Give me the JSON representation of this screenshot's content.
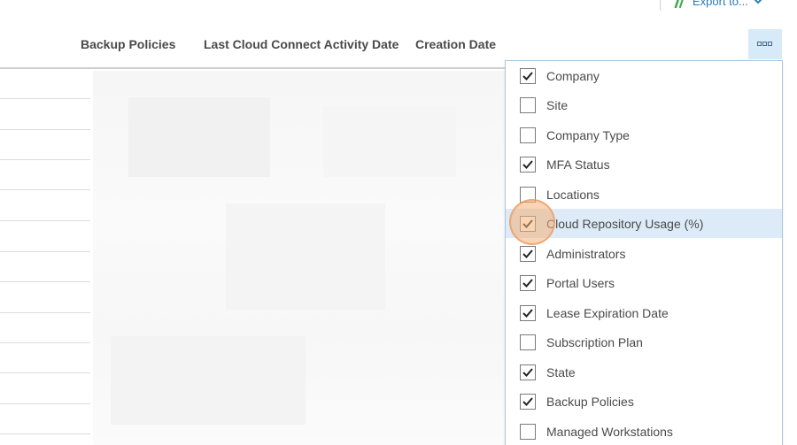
{
  "export": {
    "label": "Export to...",
    "icon": "export-icon",
    "accent": "#2a7ab8"
  },
  "columns": {
    "backup_policies": "Backup Policies",
    "last_cloud_connect_activity_date": "Last Cloud Connect Activity Date",
    "creation_date": "Creation Date"
  },
  "column_chooser": {
    "toggle_icon": "columns-icon",
    "items": [
      {
        "label": "Company",
        "checked": true
      },
      {
        "label": "Site",
        "checked": false
      },
      {
        "label": "Company Type",
        "checked": false
      },
      {
        "label": "MFA Status",
        "checked": true
      },
      {
        "label": "Locations",
        "checked": false
      },
      {
        "label": "Cloud Repository Usage (%)",
        "checked": true,
        "highlighted": true
      },
      {
        "label": "Administrators",
        "checked": true
      },
      {
        "label": "Portal Users",
        "checked": true
      },
      {
        "label": "Lease Expiration Date",
        "checked": true
      },
      {
        "label": "Subscription Plan",
        "checked": false
      },
      {
        "label": "State",
        "checked": true
      },
      {
        "label": "Backup Policies",
        "checked": true
      },
      {
        "label": "Managed Workstations",
        "checked": false
      }
    ]
  },
  "colors": {
    "header_text": "#4a4a4a",
    "highlight_row": "#dcebf7",
    "chooser_toggle_bg": "#d6eaf8",
    "cursor_marker": "#f4b078"
  }
}
